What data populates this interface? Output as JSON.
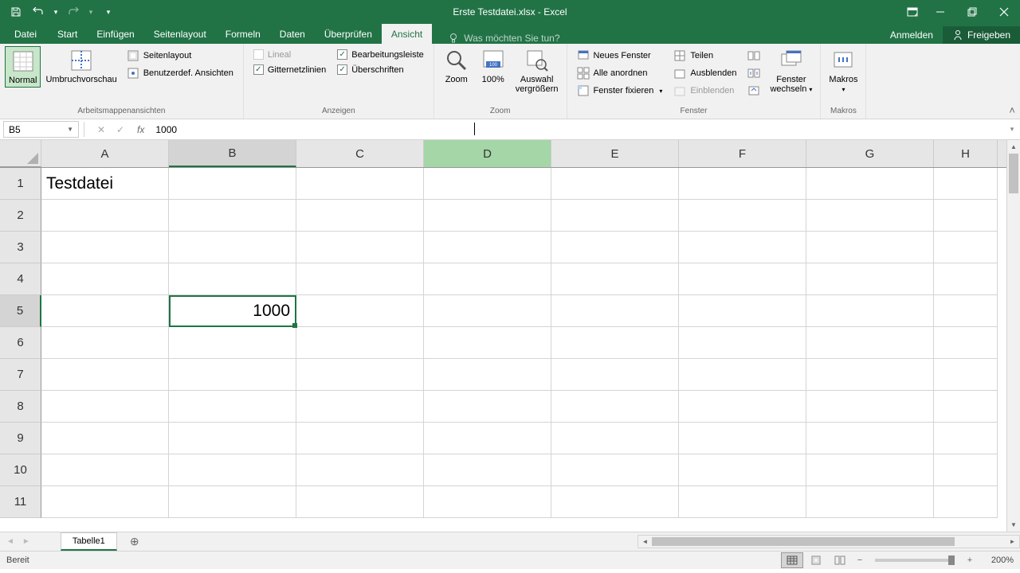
{
  "titlebar": {
    "title": "Erste Testdatei.xlsx - Excel"
  },
  "tabs": {
    "file": "Datei",
    "items": [
      "Start",
      "Einfügen",
      "Seitenlayout",
      "Formeln",
      "Daten",
      "Überprüfen",
      "Ansicht"
    ],
    "active_index": 6,
    "tell_me_placeholder": "Was möchten Sie tun?",
    "signin": "Anmelden",
    "share": "Freigeben"
  },
  "ribbon": {
    "views": {
      "normal": "Normal",
      "page_break": "Umbruchvorschau",
      "page_layout": "Seitenlayout",
      "custom": "Benutzerdef. Ansichten",
      "group": "Arbeitsmappenansichten"
    },
    "show": {
      "ruler": "Lineal",
      "formula_bar": "Bearbeitungsleiste",
      "gridlines": "Gitternetzlinien",
      "headings": "Überschriften",
      "group": "Anzeigen",
      "ruler_checked": false,
      "formula_bar_checked": true,
      "gridlines_checked": true,
      "headings_checked": true
    },
    "zoom": {
      "zoom": "Zoom",
      "hundred": "100%",
      "selection_l1": "Auswahl",
      "selection_l2": "vergrößern",
      "group": "Zoom"
    },
    "window": {
      "new_window": "Neues Fenster",
      "arrange": "Alle anordnen",
      "freeze": "Fenster fixieren",
      "split": "Teilen",
      "hide": "Ausblenden",
      "unhide": "Einblenden",
      "switch_l1": "Fenster",
      "switch_l2": "wechseln",
      "group": "Fenster"
    },
    "macros": {
      "macros": "Makros",
      "group": "Makros"
    }
  },
  "formula_bar": {
    "name_box": "B5",
    "fx": "fx",
    "formula": "1000"
  },
  "grid": {
    "columns": [
      "A",
      "B",
      "C",
      "D",
      "E",
      "F",
      "G",
      "H"
    ],
    "active_col": "B",
    "hover_col": "D",
    "rows": [
      1,
      2,
      3,
      4,
      5,
      6,
      7,
      8,
      9,
      10,
      11
    ],
    "active_row": 5,
    "cells": {
      "A1": "Testdatei",
      "B5": "1000"
    }
  },
  "sheets": {
    "active": "Tabelle1"
  },
  "status": {
    "ready": "Bereit",
    "zoom": "200%"
  }
}
